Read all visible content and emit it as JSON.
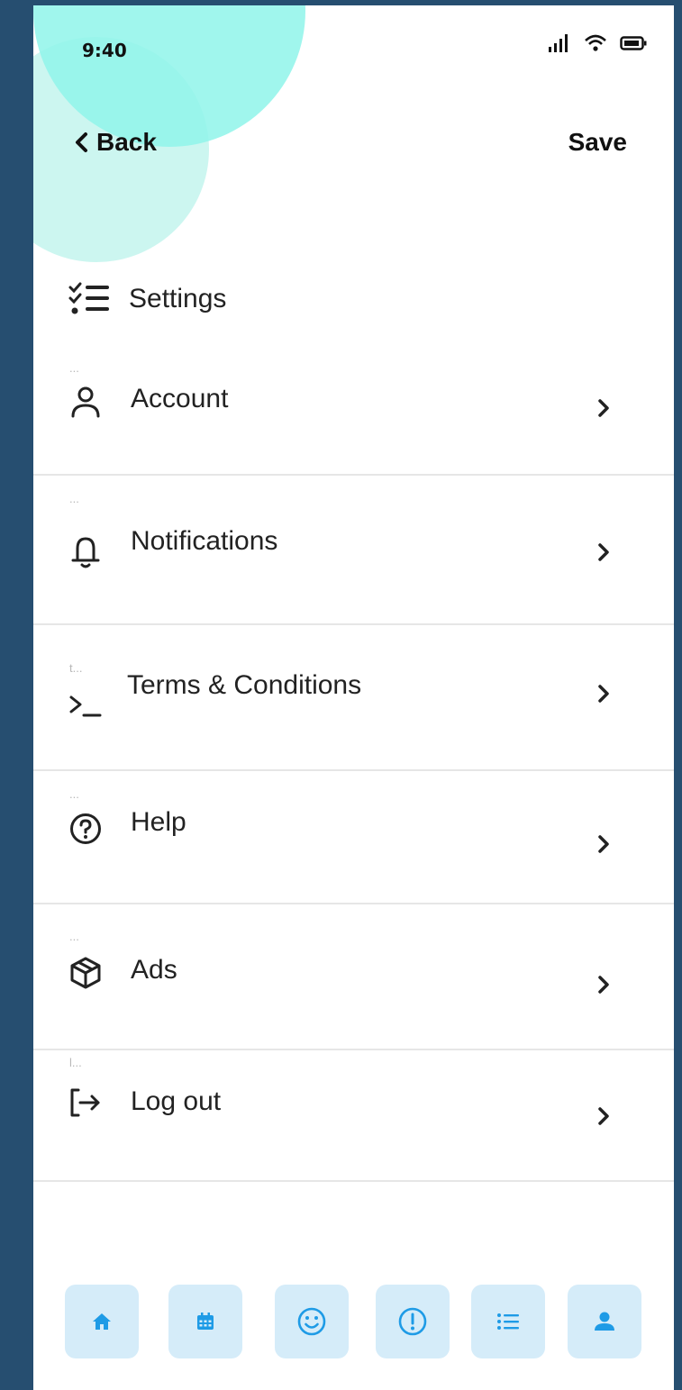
{
  "status": {
    "time": "9:40"
  },
  "nav": {
    "back_label": "Back",
    "save_label": "Save"
  },
  "header": {
    "title": "Settings",
    "icon": "checklist-icon"
  },
  "menu": {
    "items": [
      {
        "tag": "...",
        "label": "Account",
        "icon": "user-icon"
      },
      {
        "tag": "...",
        "label": "Notifications",
        "icon": "bell-icon"
      },
      {
        "tag": "t...",
        "label": "Terms & Conditions",
        "icon": "terminal-icon"
      },
      {
        "tag": "...",
        "label": "Help",
        "icon": "question-circle-icon"
      },
      {
        "tag": "...",
        "label": "Ads",
        "icon": "cube-icon"
      },
      {
        "tag": "l...",
        "label": "Log out",
        "icon": "logout-icon"
      }
    ]
  },
  "bottom_nav": {
    "tabs": [
      {
        "icon": "home-icon"
      },
      {
        "icon": "calendar-icon"
      },
      {
        "icon": "smiley-icon"
      },
      {
        "icon": "alert-icon"
      },
      {
        "icon": "list-icon"
      },
      {
        "icon": "profile-icon",
        "active": true
      }
    ]
  },
  "colors": {
    "frame": "#264e70",
    "blob_light": "#c9f5ef",
    "blob_dark": "#8ff5ea",
    "tab_bg": "#d5ecf9",
    "tab_icon": "#1e9be6"
  }
}
